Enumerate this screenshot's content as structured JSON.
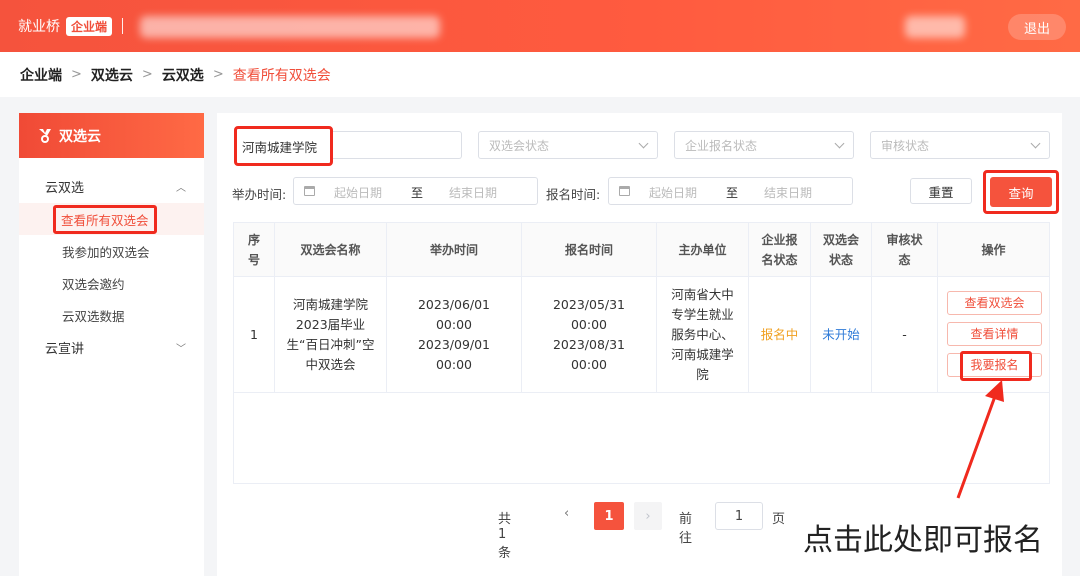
{
  "header": {
    "brand": "就业桥",
    "brand_badge": "企业端",
    "logout": "退出"
  },
  "breadcrumb": [
    "企业端",
    "双选云",
    "云双选",
    "查看所有双选会"
  ],
  "sidebar": {
    "title": "双选云",
    "groups": [
      {
        "label": "云双选",
        "expanded": true,
        "items": [
          "查看所有双选会",
          "我参加的双选会",
          "双选会邀约",
          "云双选数据"
        ]
      },
      {
        "label": "云宣讲",
        "expanded": false
      }
    ],
    "active_item": "查看所有双选会"
  },
  "filters": {
    "school_value": "河南城建学院",
    "fair_status_placeholder": "双选会状态",
    "enroll_status_placeholder": "企业报名状态",
    "audit_status_placeholder": "审核状态",
    "hold_time_label": "举办时间:",
    "enroll_time_label": "报名时间:",
    "start_date_placeholder": "起始日期",
    "end_date_placeholder": "结束日期",
    "range_separator": "至",
    "reset_label": "重置",
    "query_label": "查询"
  },
  "table": {
    "headers": [
      "序号",
      "双选会名称",
      "举办时间",
      "报名时间",
      "主办单位",
      "企业报名状态",
      "双选会状态",
      "审核状态",
      "操作"
    ],
    "rows": [
      {
        "index": "1",
        "name": "河南城建学院2023届毕业生“百日冲刺”空中双选会",
        "hold_time": "2023/06/01 00:00 2023/09/01 00:00",
        "enroll_time": "2023/05/31 00:00 2023/08/31 00:00",
        "organizer": "河南省大中专学生就业服务中心、河南城建学院",
        "enroll_status": "报名中",
        "fair_status": "未开始",
        "audit_status": "-",
        "actions": [
          "查看双选会",
          "查看详情",
          "我要报名"
        ]
      }
    ]
  },
  "pagination": {
    "total": "共 1 条",
    "prev": "‹",
    "current_page": "1",
    "next": "›",
    "goto_label": "前往",
    "goto_value": "1",
    "page_unit": "页"
  },
  "annotation": "点击此处即可报名",
  "colors": {
    "brand": "#f5533d",
    "highlight": "#f02a1e",
    "enrolling": "#f0a020",
    "not_started": "#2f7bd8"
  }
}
